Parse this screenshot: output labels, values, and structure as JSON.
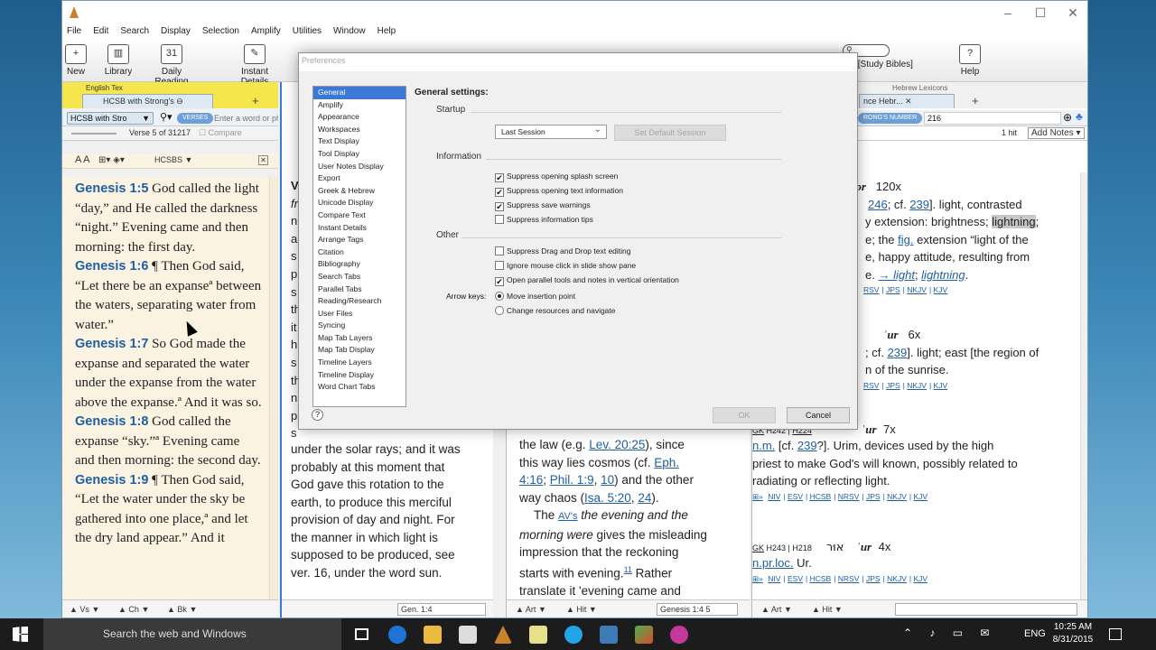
{
  "app": {
    "menu": [
      "File",
      "Edit",
      "Search",
      "Display",
      "Selection",
      "Amplify",
      "Utilities",
      "Window",
      "Help"
    ],
    "toolbar": [
      "New",
      "Library",
      "Daily Reading",
      "Instant Details"
    ],
    "toolbar_right": {
      "search_label": "rch - [Study Bibles]",
      "help": "Help"
    },
    "win_controls": {
      "min": "–",
      "max": "☐",
      "close": "✕"
    }
  },
  "left_pane": {
    "yellow_label": "English Tex",
    "tab": "HCSB with Strong's",
    "resource_select": "HCSB with Stro",
    "search_chip": "VERSES",
    "search_placeholder": "Enter a word or phras",
    "verse_info": "Verse 5 of 31217",
    "compare": "Compare",
    "font_ctrl": "A A",
    "version_badge": "HCSBS ▼",
    "verses": [
      {
        "ref": "Genesis 1:5",
        "text": "God called the light “day,” and He called the darkness “night.” Evening came and then morning: the first day."
      },
      {
        "ref": "Genesis 1:6",
        "text": "¶ Then God said, “Let there be an expanseª between the waters, separating water from water.”"
      },
      {
        "ref": "Genesis 1:7",
        "text": "So God made the expanse and separated the water under the expanse from the water above the expanse.ª And it was so."
      },
      {
        "ref": "Genesis 1:8",
        "text": "God called the expanse “sky.”ª Evening came and then morning: the second day."
      },
      {
        "ref": "Genesis 1:9",
        "text": "¶ Then God said, “Let the water under the sky be gathered into one place,ª and let the dry land appear.” And it"
      }
    ],
    "bottom": {
      "vs": "Vs",
      "ch": "Ch",
      "bk": "Bk",
      "ref": "Gen. 1:4"
    }
  },
  "mid_pane": {
    "hidden_letters": [
      "V",
      "fr",
      "n",
      "a",
      "s",
      "p",
      "s",
      "th",
      "it",
      "h",
      "s",
      "th",
      "n",
      "p",
      "s"
    ],
    "lines": [
      "under the solar rays; and it was",
      "probably at this moment that",
      "God gave this rotation to the",
      "earth, to produce this merciful",
      "provision of day and night. For",
      "the manner in which light is",
      "supposed to be produced, see",
      "ver. 16, under the word sun."
    ]
  },
  "mid2_pane": {
    "l1a": "the law (e.g. ",
    "l1link": "Lev. 20:25",
    "l1b": "), since",
    "l2a": "this way lies cosmos (cf. ",
    "l2link": "Eph.",
    "l3link": "4:16",
    "l3b": "; ",
    "l3link2": "Phil. 1:9",
    "l3c": ", ",
    "l3link3": "10",
    "l3d": ") and the other",
    "l4a": "way chaos (",
    "l4link": "Isa. 5:20",
    "l4b": ", ",
    "l4link2": "24",
    "l4c": ").",
    "l5a": "The ",
    "l5link": "AV's",
    "l5b": " the evening and the",
    "l6a": "morning were",
    "l6b": " gives the misleading",
    "l7": "impression that the reckoning",
    "l8a": "starts with evening.",
    "l8sup": "11",
    "l8b": " Rather",
    "l9": "translate it 'evening came and",
    "bottom": {
      "art": "Art",
      "hit": "Hit",
      "ref": "Genesis 1:4 5"
    }
  },
  "right_pane": {
    "yellow_label": "Hebrew Lexicons",
    "tab": "nce Hebr...",
    "chip": "RONG'S NUMBER",
    "query": "216",
    "hits": "1 hit",
    "add_notes": "Add Notes",
    "entry1": {
      "head": "ʾor",
      "count": "120x",
      "l1a": "246",
      "l1b": "; cf. ",
      "l1link": "239",
      "l1c": "]. light, contrasted",
      "l2a": "y extension: brightness; ",
      "l2hl": "lightning",
      "l2b": ";",
      "l3a": "e; the ",
      "l3link": "fig.",
      "l3b": " extension “light of the",
      "l4": "e, happy attitude, resulting from",
      "l5a": "e. ",
      "l5link1": "→ light",
      "l5b": "; ",
      "l5link2": "lightning",
      "l5c": ".",
      "links": [
        "RSV",
        "JPS",
        "NKJV",
        "KJV"
      ]
    },
    "entry2": {
      "head": "ʾur",
      "count": "6x",
      "l1a": "; cf. ",
      "l1link": "239",
      "l1b": "]. light; east [the region of",
      "l2": "n of the sunrise.",
      "links": [
        "RSV",
        "JPS",
        "NKJV",
        "KJV"
      ]
    },
    "entry3": {
      "gk": "GK",
      "h1": "H242",
      "h2": "H224",
      "head": "ʾur",
      "count": "7x",
      "l1a": "n.m.",
      "l1b": " [cf. ",
      "l1link": "239",
      "l1c": "?]. Urim, devices used by the high",
      "l2": "priest to make God's will known, possibly related to",
      "l3": "radiating or reflecting light.",
      "links": [
        "NIV",
        "ESV",
        "HCSB",
        "NRSV",
        "JPS",
        "NKJV",
        "KJV"
      ]
    },
    "entry4": {
      "gk": "GK",
      "h1": "H243",
      "h2": "H218",
      "heb": "אוּר",
      "head": "ʾur",
      "count": "4x",
      "l1a": "n.pr.loc.",
      "l1b": " Ur.",
      "links": [
        "NIV",
        "ESV",
        "HCSB",
        "NRSV",
        "JPS",
        "NKJV",
        "KJV"
      ]
    },
    "bottom": {
      "art": "Art",
      "hit": "Hit"
    }
  },
  "dialog": {
    "title": "Preferences",
    "categories": [
      "General",
      "Amplify",
      "Appearance",
      "Workspaces",
      "Text Display",
      "Tool Display",
      "User Notes Display",
      "Export",
      "Greek & Hebrew",
      "Unicode Display",
      "Compare Text",
      "Instant Details",
      "Arrange Tags",
      "Citation",
      "Bibliography",
      "Search Tabs",
      "Parallel Tabs",
      "Reading/Research",
      "User Files",
      "Syncing",
      "Map Tab Layers",
      "Map Tab Display",
      "Timeline Layers",
      "Timeline Display",
      "Word Chart Tabs"
    ],
    "selected": "General",
    "heading": "General settings:",
    "startup_label": "Startup",
    "startup_value": "Last Session",
    "set_default": "Set Default Session",
    "info_label": "Information",
    "info_options": [
      {
        "label": "Suppress opening splash screen",
        "checked": true
      },
      {
        "label": "Suppress opening text information",
        "checked": true
      },
      {
        "label": "Suppress save warnings",
        "checked": true
      },
      {
        "label": "Suppress information tips",
        "checked": false
      }
    ],
    "other_label": "Other",
    "other_options": [
      {
        "label": "Suppress Drag and Drop text editing",
        "checked": false
      },
      {
        "label": "Ignore mouse click in slide show pane",
        "checked": false
      },
      {
        "label": "Open parallel tools and notes in vertical orientation",
        "checked": true
      }
    ],
    "arrow_label": "Arrow keys:",
    "arrow_options": [
      {
        "label": "Move insertion point",
        "selected": true
      },
      {
        "label": "Change resources and navigate",
        "selected": false
      }
    ],
    "ok": "OK",
    "cancel": "Cancel",
    "help_glyph": "?"
  },
  "taskbar": {
    "search": "Search the web and Windows",
    "lang": "ENG",
    "time": "10:25 AM",
    "date": "8/31/2015"
  },
  "colors": {
    "accent": "#3b78d7",
    "link": "#1f5fa6",
    "yellow_tabs": "#f4e64c",
    "bible_bg": "#fbf3e2"
  }
}
